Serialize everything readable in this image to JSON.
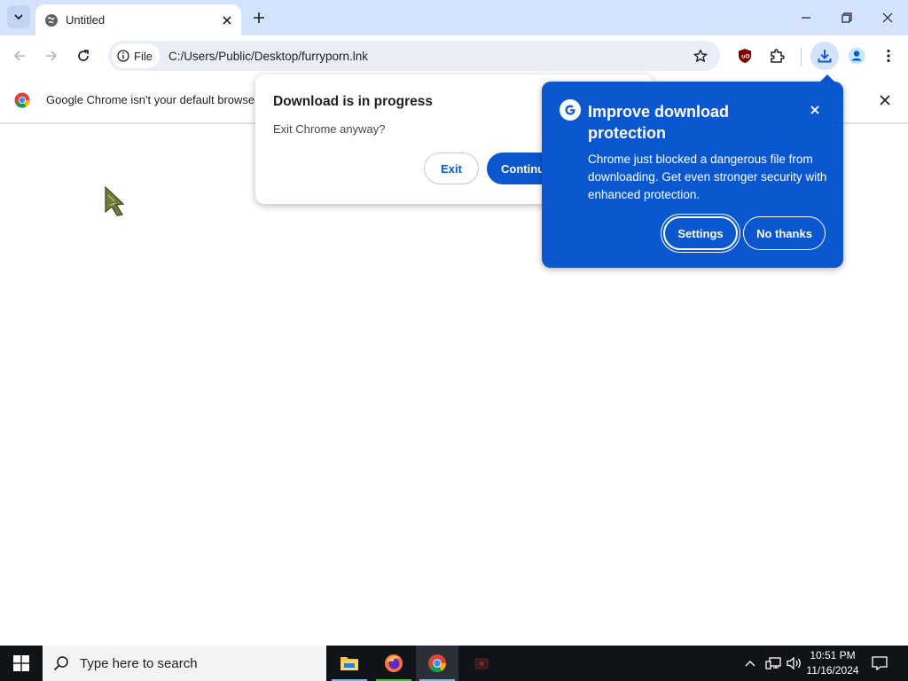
{
  "tab": {
    "title": "Untitled"
  },
  "toolbar": {
    "site_chip_label": "File",
    "url": "C:/Users/Public/Desktop/furryporn.lnk"
  },
  "infobar": {
    "text": "Google Chrome isn't your default browse"
  },
  "exit_dialog": {
    "title": "Download is in progress",
    "message": "Exit Chrome anyway?",
    "exit_label": "Exit",
    "continue_label": "Continu"
  },
  "promo": {
    "title": "Improve download protection",
    "body": "Chrome just blocked a dangerous file from downloading. Get even stronger security with enhanced protection.",
    "settings_label": "Settings",
    "no_thanks_label": "No thanks"
  },
  "taskbar": {
    "search_placeholder": "Type here to search",
    "time": "10:51 PM",
    "date": "11/16/2024"
  },
  "colors": {
    "tabstrip_bg": "#d3e3fd",
    "accent_blue": "#0b57d0",
    "taskbar_bg": "#101418"
  },
  "icons": [
    "tab-search-icon",
    "globe-icon",
    "close-icon",
    "plus-icon",
    "minimize-icon",
    "restore-icon",
    "back-icon",
    "forward-icon",
    "reload-icon",
    "info-icon",
    "star-icon",
    "ublock-icon",
    "extensions-icon",
    "download-icon",
    "profile-icon",
    "more-icon",
    "chrome-logo-icon",
    "google-g-icon",
    "windows-icon",
    "search-icon",
    "file-explorer-icon",
    "firefox-icon",
    "chrome-icon",
    "app-icon",
    "chevron-up-icon",
    "network-icon",
    "volume-icon",
    "notification-icon"
  ]
}
